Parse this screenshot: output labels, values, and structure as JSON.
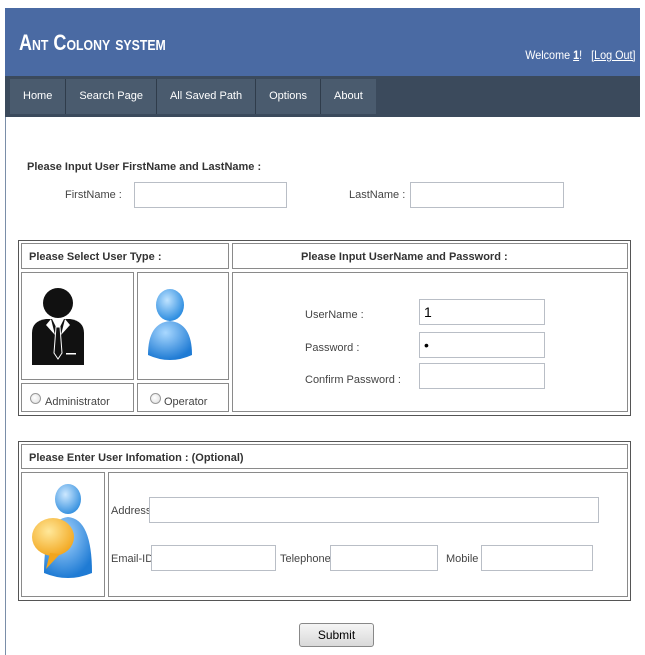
{
  "header": {
    "title": "Ant Colony system",
    "welcome_prefix": "Welcome",
    "user": "1",
    "welcome_suffix": "!",
    "logout": "[Log Out]"
  },
  "nav": {
    "items": [
      {
        "label": "Home"
      },
      {
        "label": "Search Page"
      },
      {
        "label": "All Saved Path"
      },
      {
        "label": "Options"
      },
      {
        "label": "About"
      }
    ]
  },
  "name_section": {
    "heading": "Please Input User FirstName and LastName :",
    "first_label": "FirstName :",
    "first_value": "",
    "last_label": "LastName :",
    "last_value": ""
  },
  "type_section": {
    "heading": "Please Select User Type :",
    "admin_label": "Administrator",
    "operator_label": "Operator"
  },
  "credentials": {
    "heading": "Please Input UserName and Password :",
    "username_label": "UserName :",
    "username_value": "1",
    "password_label": "Password :",
    "password_value": "•",
    "confirm_label": "Confirm Password :",
    "confirm_value": ""
  },
  "info_section": {
    "heading": "Please Enter User Infomation : (Optional)",
    "address_label": "Address :",
    "email_label": "Email-ID :",
    "telephone_label": "Telephone :",
    "mobile_label": "Mobile :"
  },
  "submit_label": "Submit",
  "colors": {
    "header_bg": "#4a6aa3",
    "nav_bg": "#3b4a5c"
  }
}
